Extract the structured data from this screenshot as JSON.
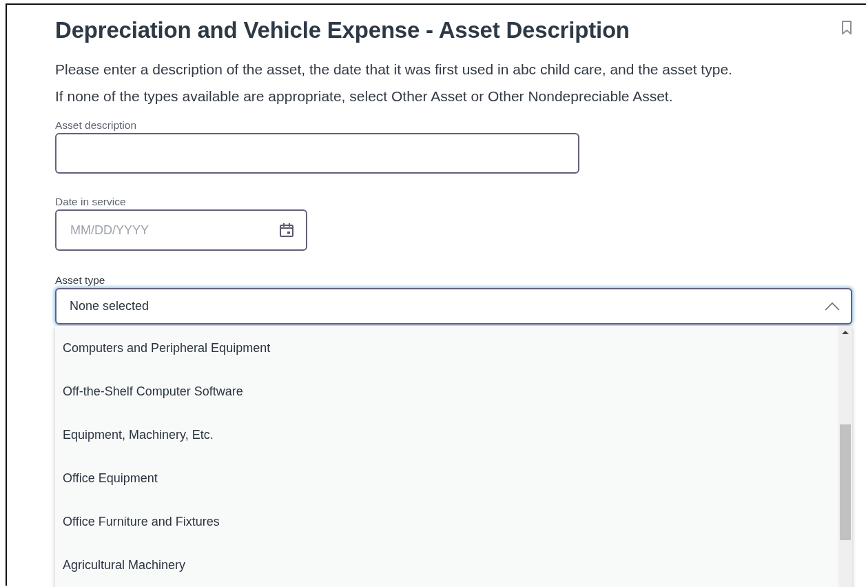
{
  "page": {
    "title": "Depreciation and Vehicle Expense - Asset Description",
    "instructions": "Please enter a description of the asset, the date that it was first used in abc child care, and the asset type. If none of the types available are appropriate, select Other Asset or Other Nondepreciable Asset."
  },
  "fields": [
    {
      "kind": "text",
      "label": "Asset description"
    },
    {
      "kind": "date",
      "label": "Date in service",
      "placeholder": "MM/DD/YYYY"
    },
    {
      "kind": "select",
      "label": "Asset type",
      "value": "None selected",
      "expanded": true,
      "options": [
        {
          "label": "Computers and Peripheral Equipment",
          "selected": false
        },
        {
          "label": "Off-the-Shelf Computer Software",
          "selected": false
        },
        {
          "label": "Equipment, Machinery, Etc.",
          "selected": false
        },
        {
          "label": "Office Equipment",
          "selected": false
        },
        {
          "label": "Office Furniture and Fixtures",
          "selected": false
        },
        {
          "label": "Agricultural Machinery",
          "selected": false
        }
      ]
    }
  ]
}
